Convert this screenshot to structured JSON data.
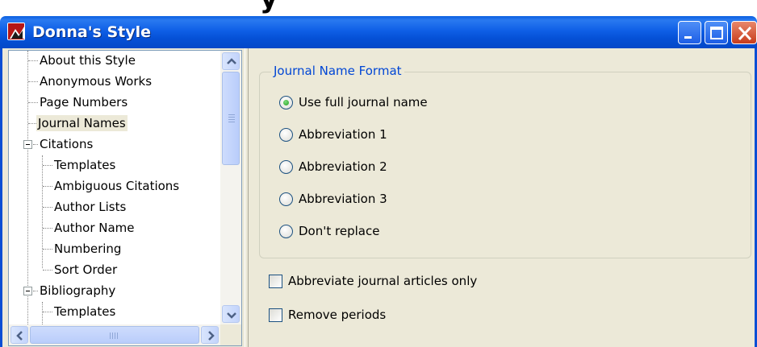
{
  "window": {
    "title": "Donna's Style",
    "clipped_heading": "y"
  },
  "tree": {
    "items": [
      {
        "label": "About this Style",
        "level": 0
      },
      {
        "label": "Anonymous Works",
        "level": 0
      },
      {
        "label": "Page Numbers",
        "level": 0
      },
      {
        "label": "Journal Names",
        "level": 0,
        "selected": true
      },
      {
        "label": "Citations",
        "level": 0,
        "expandable": true,
        "expanded": true
      },
      {
        "label": "Templates",
        "level": 1
      },
      {
        "label": "Ambiguous Citations",
        "level": 1
      },
      {
        "label": "Author Lists",
        "level": 1
      },
      {
        "label": "Author Name",
        "level": 1
      },
      {
        "label": "Numbering",
        "level": 1
      },
      {
        "label": "Sort Order",
        "level": 1
      },
      {
        "label": "Bibliography",
        "level": 0,
        "expandable": true,
        "expanded": true
      },
      {
        "label": "Templates",
        "level": 1
      }
    ]
  },
  "journal_format": {
    "title": "Journal Name Format",
    "options": [
      {
        "label": "Use full journal name",
        "checked": true
      },
      {
        "label": "Abbreviation 1",
        "checked": false
      },
      {
        "label": "Abbreviation 2",
        "checked": false
      },
      {
        "label": "Abbreviation 3",
        "checked": false
      },
      {
        "label": "Don't replace",
        "checked": false
      }
    ]
  },
  "checkboxes": [
    {
      "label": "Abbreviate journal articles only",
      "checked": false
    },
    {
      "label": "Remove periods",
      "checked": false
    }
  ],
  "colors": {
    "titlebar": "#0550d6",
    "group_title": "#0046d5",
    "face": "#ece9d8",
    "close_button": "#c83c1c"
  }
}
